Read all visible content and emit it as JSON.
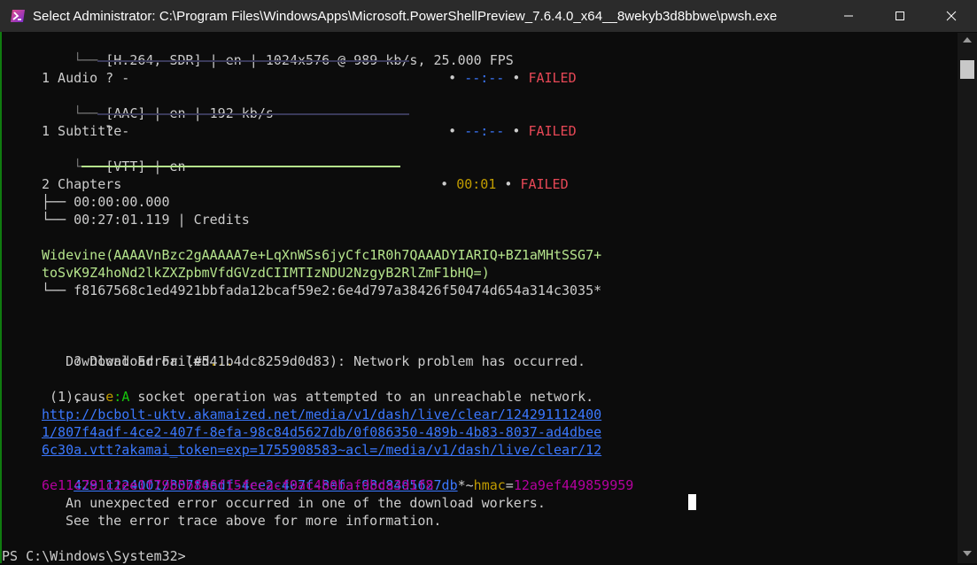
{
  "window": {
    "title": "Select Administrator: C:\\Program Files\\WindowsApps\\Microsoft.PowerShellPreview_7.6.4.0_x64__8wekyb3d8bbwe\\pwsh.exe",
    "icon": "powershell-icon",
    "controls": [
      "minimize",
      "maximize",
      "close"
    ]
  },
  "terminal": {
    "video_info": "└── [H.264, SDR] | en | 1024x576 @ 989 kb/s, 25.000 FPS",
    "video_progress": {
      "glyph": "?",
      "dash": "-",
      "time": "--:--",
      "sep": "•",
      "status": "FAILED",
      "progress": 0.0
    },
    "audio_heading": "1 Audio",
    "audio_info": "└── [AAC] | en | 192 kb/s",
    "audio_progress": {
      "glyph": "?",
      "dash": "-",
      "time": "--:--",
      "sep": "•",
      "status": "FAILED",
      "progress": 0.0
    },
    "subtitle_heading": "1 Subtitle",
    "subtitle_info": "└── [VTT] | en",
    "subtitle_progress": {
      "time": "00:01",
      "sep": "•",
      "status": "FAILED",
      "progress": 1.0
    },
    "chapters_heading": "2 Chapters",
    "chapter_1": "├── 00:00:00.000",
    "chapter_2": "└── 00:27:01.119 | Credits",
    "widevine_line1": "Widevine(AAAAVnBzc2gAAAAA7e+LqXnWSs6jyCfc1R0h7QAAADYIARIQ+BZ1aMHtSSG7+",
    "widevine_line2": "toSvK9Z4hoNd2lkZXZpbmVfdGVzdCIIMTIzNDU2NzgyB2RlZmF1bHQ=)",
    "widevine_key": "└── f8167568c1ed4921bbfada12bcaf59e2:6e4d797a38426f50474d654a314c3035*",
    "failed_glyph": "?",
    "failed_text": "Download Failed",
    "failed_dots": "...",
    "error_line": "Download Error (#541b4dc8259d0d83): Network problem has occurred.",
    "cause_prefix": "caus",
    "cause_e": "e",
    "cause_colon": ":",
    "cause_a": "A",
    "cause_rest": " socket operation was attempted to an unreachable network.",
    "code_line": " (1),",
    "url_line1": "http://bcbolt-uktv.akamaized.net/media/v1/dash/live/clear/124291112400",
    "url_line2": "1/807f4adf-4ce2-407f-8efa-98c84d5627db/0f086350-489b-4b83-8037-ad4dbee",
    "url_line3": "6c30a.vtt?akamai_token=exp=1755908583~acl=/media/v1/dash/live/clear/12",
    "url_line4a": "42911124001/807f4adf-4ce2-407f-8efa-98c84d5627db",
    "url_line4b": "*~",
    "url_line4c": "hmac",
    "url_line4d": "=",
    "url_line4e": "12a9ef449859959",
    "url_line5": "6e11c781c2ee1f79b5b806f15fecacf9ac4b0bafdbda391f8",
    "unexpected_line": "An unexpected error occurred in one of the download workers.",
    "trace_line": "See the error trace above for more information.",
    "prompt": "PS C:\\Windows\\System32>"
  },
  "colors": {
    "background": "#0c0c0c",
    "text": "#cccccc",
    "failed": "#e74856",
    "link": "#3b78ff",
    "hmac_value": "#b4009e",
    "accent_green": "#16c60c",
    "progress_done": "#b5e48c"
  }
}
